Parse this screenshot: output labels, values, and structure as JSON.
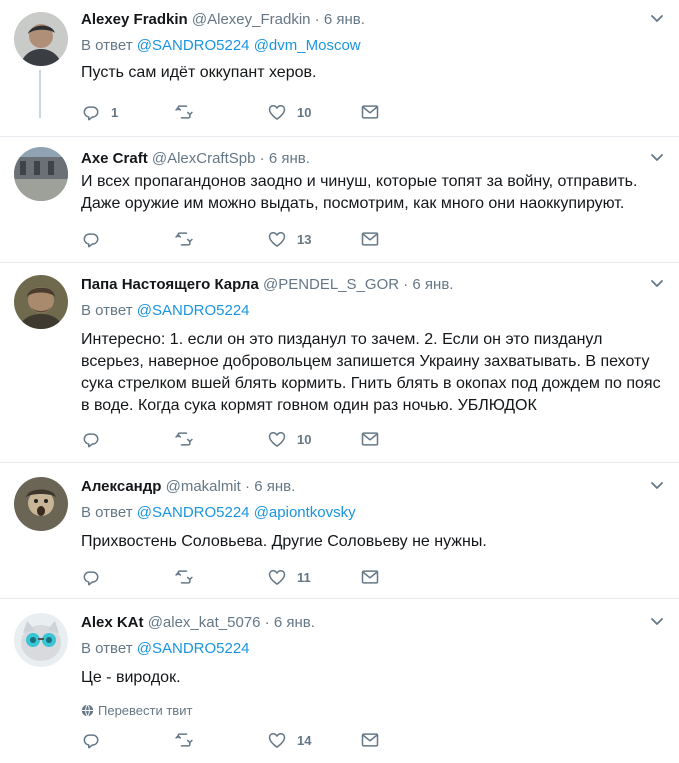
{
  "tweets": [
    {
      "name": "Alexey Fradkin",
      "handle": "@Alexey_Fradkin",
      "time": "6 янв.",
      "reply_prefix": "В ответ",
      "mentions": [
        "@SANDRO5224",
        "@dvm_Moscow"
      ],
      "text": "Пусть сам идёт оккупант херов.",
      "reply_count": "1",
      "retweet_count": "",
      "like_count": "10"
    },
    {
      "name": "Axe Craft",
      "handle": "@AlexCraftSpb",
      "time": "6 янв.",
      "text": "И всех пропагандонов заодно и чинуш, которые топят за войну, отправить. Даже оружие им можно выдать, посмотрим, как много они наоккупируют.",
      "reply_count": "",
      "retweet_count": "",
      "like_count": "13"
    },
    {
      "name": "Папа Настоящего Карла",
      "handle": "@PENDEL_S_GOR",
      "time": "6 янв.",
      "reply_prefix": "В ответ",
      "mentions": [
        "@SANDRO5224"
      ],
      "text": "Интересно: 1. если он это пизданул то зачем. 2. Если он это пизданул всерьез, наверное добровольцем запишется Украину захватывать. В пехоту сука стрелком вшей блять кормить. Гнить блять в окопах под дождем по пояс в воде. Когда сука кормят говном один раз ночью. УБЛЮДОК",
      "reply_count": "",
      "retweet_count": "",
      "like_count": "10"
    },
    {
      "name": "Александр",
      "handle": "@makalmit",
      "time": "6 янв.",
      "reply_prefix": "В ответ",
      "mentions": [
        "@SANDRO5224",
        "@apiontkovsky"
      ],
      "text": "Прихвостень Соловьева. Другие Соловьеву не нужны.",
      "reply_count": "",
      "retweet_count": "",
      "like_count": "11"
    },
    {
      "name": "Alex KAt",
      "handle": "@alex_kat_5076",
      "time": "6 янв.",
      "reply_prefix": "В ответ",
      "mentions": [
        "@SANDRO5224"
      ],
      "text": "Це - виродок.",
      "translate": "Перевести твит",
      "reply_count": "",
      "retweet_count": "",
      "like_count": "14"
    }
  ],
  "separator_dot": "·",
  "colors": {
    "link": "#1b95e0",
    "muted": "#657786",
    "border": "#e6ecf0"
  }
}
